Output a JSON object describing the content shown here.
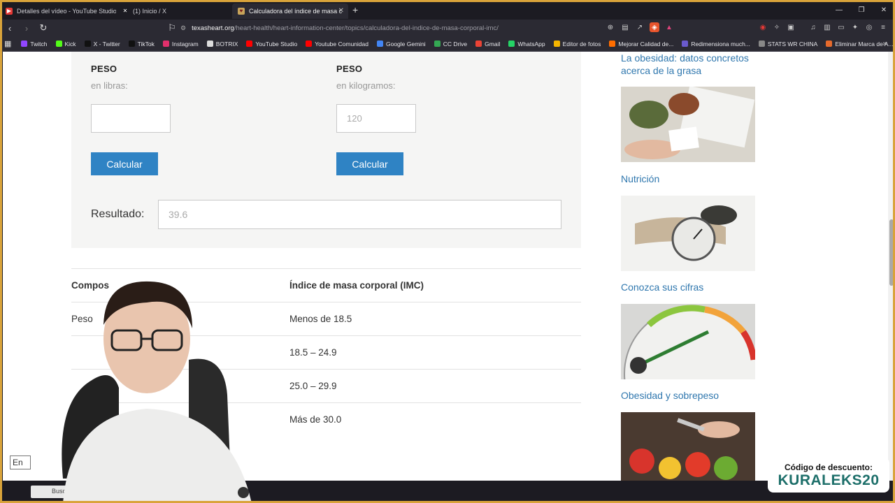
{
  "tabs": [
    {
      "title": "Detalles del vídeo - YouTube Studio",
      "icon": "youtube-studio-icon"
    },
    {
      "title": "(1) Inicio / X",
      "icon": "x-icon"
    },
    {
      "title": "Calculadora del índice de masa c",
      "icon": "texas-heart-icon"
    }
  ],
  "url": {
    "host": "texasheart.org",
    "path": "/heart-health/heart-information-center/topics/calculadora-del-indice-de-masa-corporal-imc/"
  },
  "bookmarks": [
    "Twitch",
    "Kick",
    "X - Twitter",
    "TikTok",
    "Instagram",
    "BOTRIX",
    "YouTube Studio",
    "Youtube Comunidad",
    "Google Gemini",
    "CC Drive",
    "Gmail",
    "WhatsApp",
    "Editor de fotos",
    "Mejorar Calidad de...",
    "Redimensiona much...",
    "STATS WR CHINA",
    "Eliminar Marca de A..."
  ],
  "bookmark_colors": [
    "#9146ff",
    "#53fc18",
    "#111111",
    "#111111",
    "#e1306c",
    "#dddddd",
    "#ff0000",
    "#ff0000",
    "#4285f4",
    "#34a853",
    "#ea4335",
    "#25d366",
    "#f4b400",
    "#ff6d00",
    "#6a5acd",
    "#888888",
    "#e66a2c"
  ],
  "calculator": {
    "left": {
      "label": "PESO",
      "unit": "en libras:",
      "value": "",
      "button": "Calcular"
    },
    "right": {
      "label": "PESO",
      "unit": "en kilogramos:",
      "value": "120",
      "button": "Calcular"
    },
    "result_label": "Resultado:",
    "result_value": "39.6"
  },
  "table": {
    "headers": [
      "Compos",
      "Índice de masa corporal (IMC)"
    ],
    "rows": [
      [
        "Peso",
        "Menos de 18.5"
      ],
      [
        "",
        "18.5 – 24.9"
      ],
      [
        "",
        "25.0 – 29.9"
      ],
      [
        "",
        "Más de 30.0"
      ]
    ]
  },
  "sidebar": {
    "links": [
      "La obesidad: datos concretos acerca de la grasa",
      "Nutrición",
      "Conozca sus cifras",
      "Obesidad y sobrepeso"
    ]
  },
  "promo": {
    "line1": "Código de descuento:",
    "code": "KURALEKS20"
  },
  "taskbar": {
    "search": "Buscar",
    "chip": "En"
  }
}
